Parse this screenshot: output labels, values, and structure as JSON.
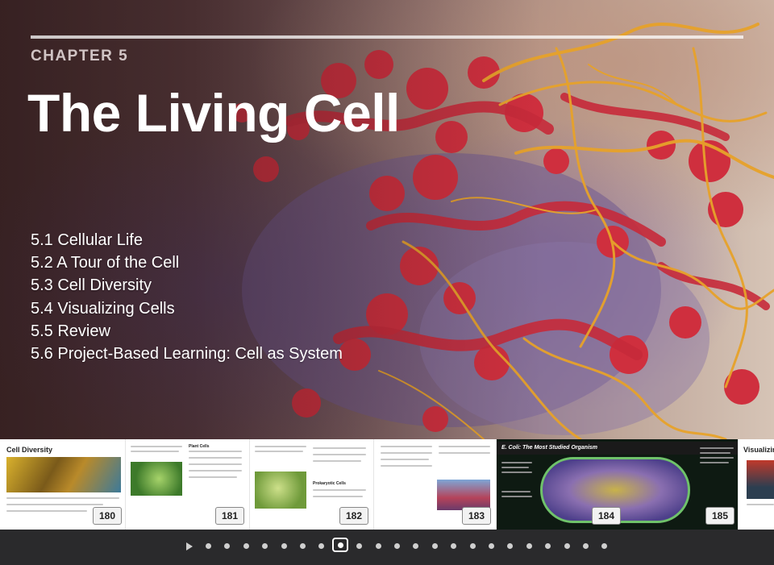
{
  "chapter": {
    "label": "CHAPTER 5",
    "title": "The Living Cell"
  },
  "sections": [
    "5.1 Cellular Life",
    "5.2 A Tour of the Cell",
    "5.3 Cell Diversity",
    "5.4 Visualizing Cells",
    "5.5 Review",
    "5.6 Project-Based Learning: Cell as System"
  ],
  "thumbnails": {
    "pages": [
      "180",
      "181",
      "182",
      "183",
      "184",
      "185"
    ],
    "headings": {
      "p180": "Cell Diversity",
      "p181": "Plant Cells",
      "p182_sub": "Prokaryotic Cells",
      "p184_banner": "E. Coli: The Most Studied Organism",
      "p185": "Visualizing C"
    }
  },
  "navigation": {
    "dot_count": 22,
    "current_index": 7
  },
  "colors": {
    "title_text": "#ffffff",
    "chapter_label": "#e6dcdc",
    "strip_background": "#ffffff",
    "nav_background": "#2a2a2c",
    "fiber_red": "#d8323f",
    "fiber_gold": "#e7a22a"
  },
  "icons": {
    "play": "play-icon",
    "hero": "cell-illustration"
  }
}
